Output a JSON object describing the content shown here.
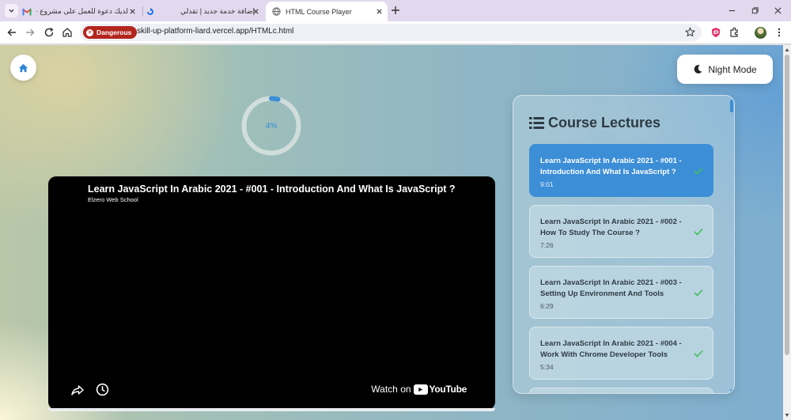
{
  "browser": {
    "tabs": [
      {
        "title": "لديك دعوة للعمل على مشروع -",
        "favicon": "gmail-icon"
      },
      {
        "title": "إضافة خدمة جديد | تقدلي",
        "favicon": "site-icon"
      },
      {
        "title": "HTML Course Player",
        "favicon": "globe-icon",
        "active": true
      }
    ],
    "security_chip": "Dangerous",
    "url": "skill-up-platform-liard.vercel.app/HTMLc.html"
  },
  "page": {
    "night_mode_label": "Night Mode",
    "progress": {
      "percent_text": "4%",
      "value": 0.04
    },
    "video": {
      "title": "Learn JavaScript In Arabic 2021 - #001 - Introduction And What Is JavaScript ?",
      "channel": "Elzero Web School",
      "watch_on": "Watch on",
      "brand": "YouTube"
    },
    "lectures": {
      "heading": "Course Lectures",
      "items": [
        {
          "title": "Learn JavaScript In Arabic 2021 - #001 - Introduction And What Is JavaScript ?",
          "duration": "9:01",
          "active": true
        },
        {
          "title": "Learn JavaScript In Arabic 2021 - #002 - How To Study The Course ?",
          "duration": "7:26"
        },
        {
          "title": "Learn JavaScript In Arabic 2021 - #003 - Setting Up Environment And Tools",
          "duration": "6:29"
        },
        {
          "title": "Learn JavaScript In Arabic 2021 - #004 - Work With Chrome Developer Tools",
          "duration": "5:34"
        }
      ]
    }
  },
  "colors": {
    "accent": "#3c8ed7",
    "danger": "#b3261e",
    "check": "#3fbf5a"
  }
}
